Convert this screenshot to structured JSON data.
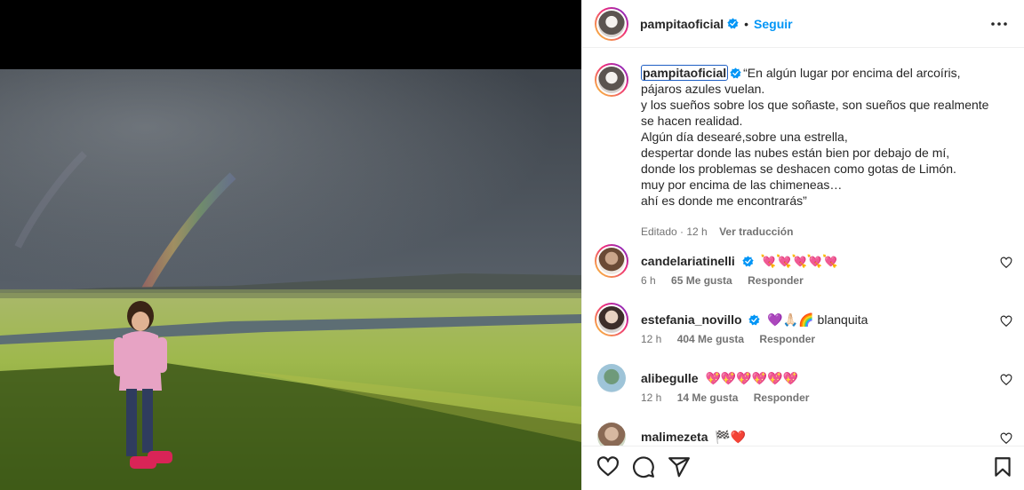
{
  "post": {
    "username": "pampitaoficial",
    "separator": "•",
    "follow_label": "Seguir",
    "caption_user": "pampitaoficial",
    "caption_lines": [
      "“En algún lugar por encima del arcoíris,",
      "pájaros azules vuelan.",
      "y los sueños sobre los que soñaste, son sueños que realmente",
      "se hacen realidad.",
      "Algún día desearé,sobre una estrella,",
      "despertar donde las nubes están bien por debajo de mí,",
      "donde los problemas se deshacen como gotas de Limón.",
      "muy por encima de las chimeneas…",
      "ahí es donde me encontrarás”"
    ],
    "edited": "Editado · 12 h",
    "see_translation": "Ver traducción"
  },
  "comments": [
    {
      "user": "candelariatinelli",
      "verified": true,
      "text": "💘💘💘💘💘",
      "time": "6 h",
      "likes": "65 Me gusta",
      "reply": "Responder"
    },
    {
      "user": "estefania_novillo",
      "verified": true,
      "text": "💜🙏🏻🌈 blanquita",
      "time": "12 h",
      "likes": "404 Me gusta",
      "reply": "Responder"
    },
    {
      "user": "alibegulle",
      "verified": false,
      "text": "💖💖💖💖💖💖",
      "time": "12 h",
      "likes": "14 Me gusta",
      "reply": "Responder"
    },
    {
      "user": "malimezeta",
      "verified": false,
      "text": "🏁❤️",
      "time": "",
      "likes": "",
      "reply": ""
    }
  ],
  "colors": {
    "accent": "#0095f6",
    "text": "#262626",
    "muted": "#737373",
    "verified": "#0095f6"
  },
  "icons": [
    "verified-badge-icon",
    "more-options-icon",
    "heart-icon",
    "comment-icon",
    "share-icon",
    "save-icon"
  ]
}
